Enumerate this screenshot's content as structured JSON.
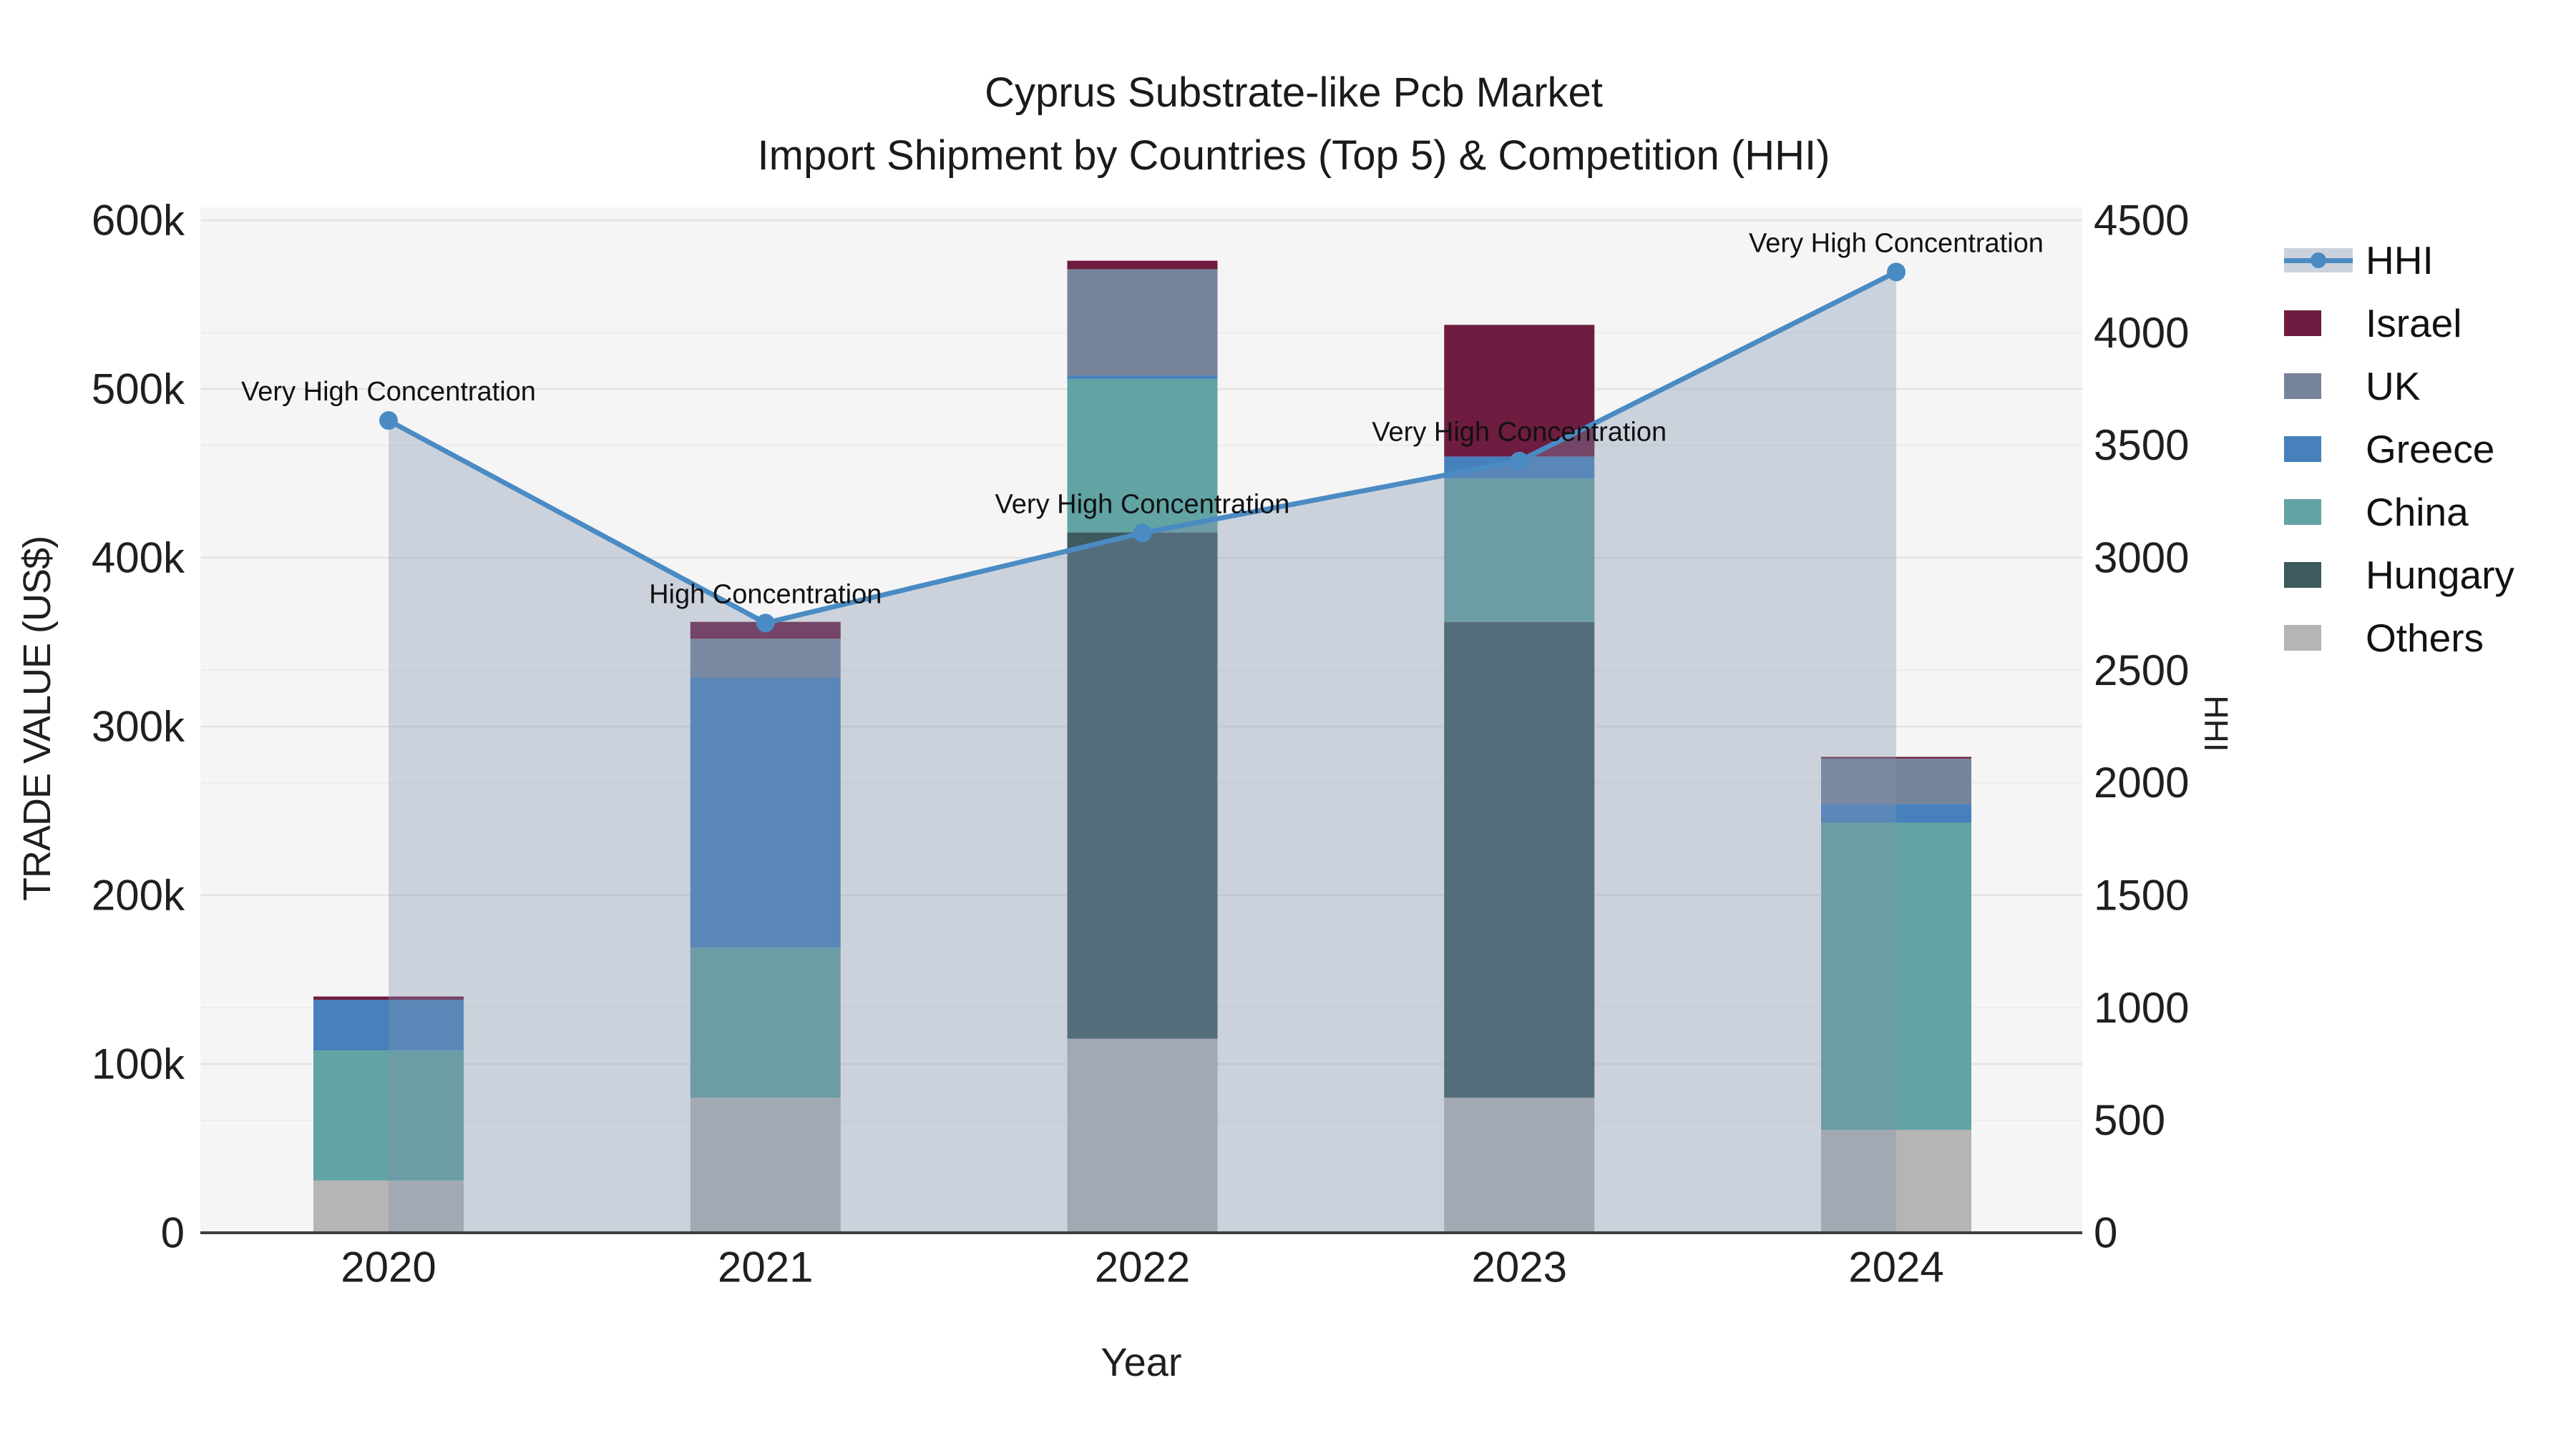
{
  "title": {
    "line1": "Cyprus Substrate-like Pcb Market",
    "line2": "Import Shipment by Countries (Top 5) & Competition (HHI)"
  },
  "chart_data": {
    "type": "bar",
    "subtype": "stacked-bar-with-line",
    "title": "Cyprus Substrate-like Pcb Market",
    "subtitle": "Import Shipment by Countries (Top 5) & Competition (HHI)",
    "categories": [
      "2020",
      "2021",
      "2022",
      "2023",
      "2024"
    ],
    "stack_series_bottom_to_top": [
      {
        "name": "Others",
        "color": "#b5b5b4",
        "values": [
          31000,
          80000,
          115000,
          80000,
          61000
        ]
      },
      {
        "name": "Hungary",
        "color": "#3d5a5e",
        "values": [
          0,
          0,
          300000,
          282000,
          0
        ]
      },
      {
        "name": "China",
        "color": "#62a3a4",
        "values": [
          77000,
          89000,
          91000,
          85000,
          182000
        ]
      },
      {
        "name": "Greece",
        "color": "#4681bd",
        "values": [
          30000,
          160000,
          2000,
          13000,
          11000
        ]
      },
      {
        "name": "UK",
        "color": "#76849b",
        "values": [
          0,
          23000,
          63000,
          0,
          27000
        ]
      },
      {
        "name": "Israel",
        "color": "#6e1c3f",
        "values": [
          2000,
          10000,
          5000,
          78000,
          1000
        ]
      }
    ],
    "bar_totals": [
      140000,
      362000,
      576000,
      538000,
      282000
    ],
    "line_series": {
      "name": "HHI",
      "color": "#4a8bc4",
      "values": [
        3610,
        2710,
        3110,
        3430,
        4270
      ]
    },
    "annotations": [
      "Very High Concentration",
      "High Concentration",
      "Very High Concentration",
      "Very High Concentration",
      "Very High Concentration"
    ],
    "y_left": {
      "title": "TRADE VALUE (US$)",
      "tick_labels": [
        "0",
        "100k",
        "200k",
        "300k",
        "400k",
        "500k",
        "600k"
      ],
      "tick_values": [
        0,
        100000,
        200000,
        300000,
        400000,
        500000,
        600000
      ],
      "max": 600000
    },
    "y_right": {
      "title": "HHI",
      "tick_labels": [
        "0",
        "500",
        "1000",
        "1500",
        "2000",
        "2500",
        "3000",
        "3500",
        "4000",
        "4500"
      ],
      "tick_values": [
        0,
        500,
        1000,
        1500,
        2000,
        2500,
        3000,
        3500,
        4000,
        4500
      ],
      "max": 4500
    },
    "x_axis": {
      "title": "Year"
    },
    "legend_position": "right",
    "grid": true
  },
  "legend": {
    "items": [
      {
        "label": "HHI",
        "type": "line"
      },
      {
        "label": "Israel",
        "type": "swatch"
      },
      {
        "label": "UK",
        "type": "swatch"
      },
      {
        "label": "Greece",
        "type": "swatch"
      },
      {
        "label": "China",
        "type": "swatch"
      },
      {
        "label": "Hungary",
        "type": "swatch"
      },
      {
        "label": "Others",
        "type": "swatch"
      }
    ]
  },
  "colors": {
    "hhi_line": "#4a8bc4",
    "hhi_area_fill": "rgba(128,145,176,0.35)",
    "hhi_legend_band": "#ccd2dd",
    "plot_background": "#f5f5f5",
    "grid_left": "#e3e3e3",
    "grid_right": "#ececec",
    "axis_line": "#3f3f3f",
    "text": "#1f1f1f"
  }
}
